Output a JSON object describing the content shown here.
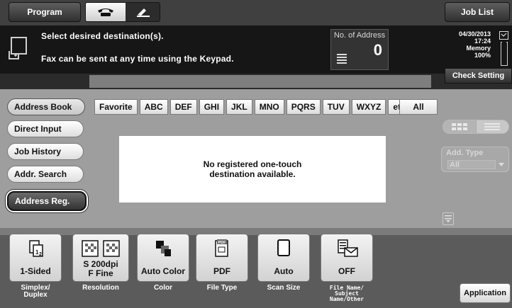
{
  "topbar": {
    "program_label": "Program",
    "joblist_label": "Job List",
    "mode_icons": [
      "phone-icon",
      "fax-handset-icon"
    ]
  },
  "message": {
    "line1": "Select desired destination(s).",
    "line2": "Fax can be sent at any time using the Keypad.",
    "icon": "fax-document-icon"
  },
  "address_count": {
    "label": "No. of Address",
    "value": "0",
    "icon": "address-list-icon"
  },
  "status": {
    "date": "04/30/2013",
    "time": "17:24",
    "memory_label": "Memory",
    "memory_percent": "100%",
    "memory_fill": 1.0,
    "check_setting_label": "Check Setting"
  },
  "sidebar": {
    "items": [
      {
        "label": "Address Book",
        "selected": true
      },
      {
        "label": "Direct Input"
      },
      {
        "label": "Job History"
      },
      {
        "label": "Addr. Search"
      },
      {
        "label": "Address Reg.",
        "highlighted": true
      }
    ]
  },
  "index_tabs": {
    "items": [
      "Favorite",
      "ABC",
      "DEF",
      "GHI",
      "JKL",
      "MNO",
      "PQRS",
      "TUV",
      "WXYZ",
      "etc"
    ],
    "all_label": "All"
  },
  "list": {
    "empty_line1": "No registered one-touch",
    "empty_line2": "destination available."
  },
  "add_type": {
    "label": "Add. Type",
    "value": "All"
  },
  "functions": [
    {
      "value": "1-Sided",
      "caption": "Simplex/ Duplex",
      "icon": "simplex-duplex-icon"
    },
    {
      "value_line1": "S 200dpi",
      "value_line2": "F Fine",
      "caption": "Resolution",
      "icon": "resolution-icon"
    },
    {
      "value": "Auto Color",
      "caption": "Color",
      "icon": "color-icon"
    },
    {
      "value": "PDF",
      "caption": "File Type",
      "icon": "pdf-file-icon",
      "icon_text": "PDF"
    },
    {
      "value": "Auto",
      "caption": "Scan Size",
      "icon": "scan-size-icon"
    },
    {
      "value": "OFF",
      "caption_line1": "File Name/",
      "caption_line2": "Subject",
      "caption_line3": "Name/Other",
      "icon": "file-name-subject-icon"
    }
  ],
  "application_label": "Application",
  "colors": {
    "background": "#2b2b2b",
    "message_band": "#161616",
    "panel": "#9e9e9e",
    "function_bar": "#5b5b5b"
  }
}
